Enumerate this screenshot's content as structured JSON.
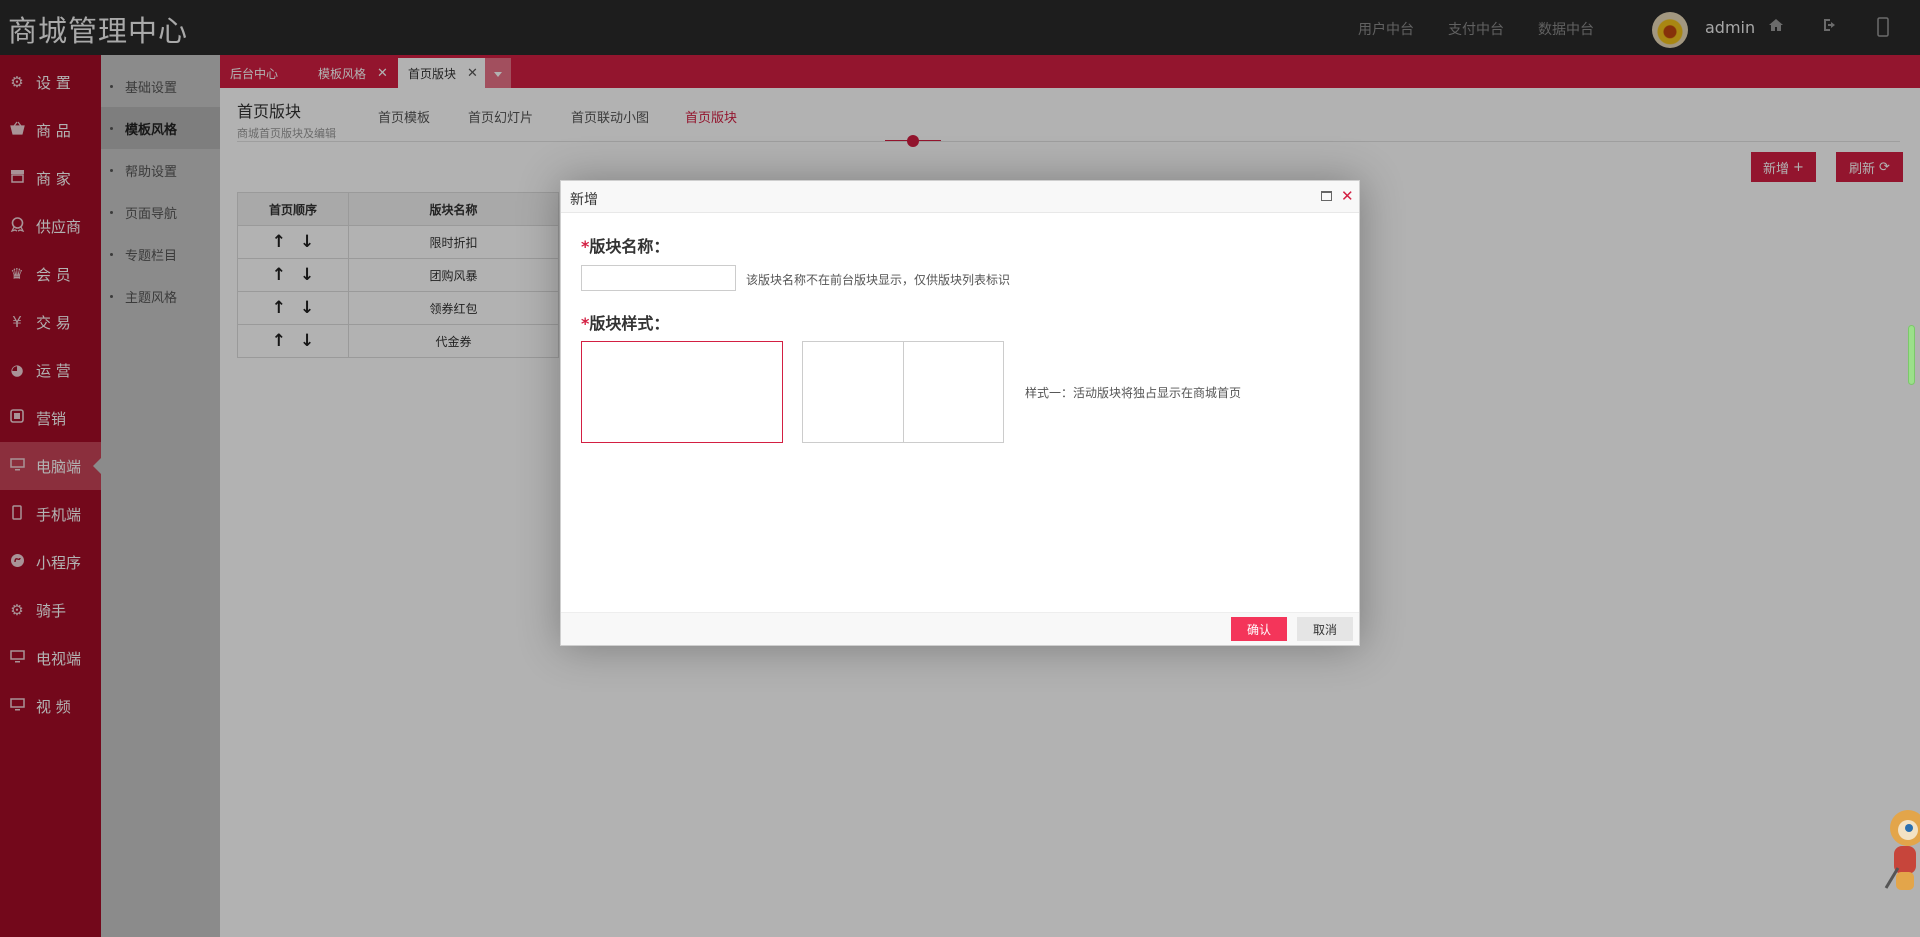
{
  "header": {
    "brand": "商城管理中心",
    "links": [
      "用户中台",
      "支付中台",
      "数据中台"
    ],
    "username": "admin"
  },
  "sidebar": {
    "items": [
      {
        "icon": "gear-icon",
        "label": "设 置"
      },
      {
        "icon": "basket-icon",
        "label": "商 品"
      },
      {
        "icon": "store-icon",
        "label": "商 家"
      },
      {
        "icon": "supplier-icon",
        "label": "供应商"
      },
      {
        "icon": "crown-icon",
        "label": "会 员"
      },
      {
        "icon": "yen-icon",
        "label": "交 易"
      },
      {
        "icon": "pie-chart-icon",
        "label": "运 营"
      },
      {
        "icon": "marketing-icon",
        "label": "营销"
      },
      {
        "icon": "desktop-icon",
        "label": "电脑端",
        "active": true
      },
      {
        "icon": "mobile-icon",
        "label": "手机端"
      },
      {
        "icon": "miniapp-icon",
        "label": "小程序"
      },
      {
        "icon": "gear-icon",
        "label": "骑手"
      },
      {
        "icon": "tv-icon",
        "label": "电视端"
      },
      {
        "icon": "video-icon",
        "label": "视 频"
      }
    ]
  },
  "subnav": {
    "items": [
      {
        "label": "基础设置"
      },
      {
        "label": "模板风格",
        "active": true
      },
      {
        "label": "帮助设置"
      },
      {
        "label": "页面导航"
      },
      {
        "label": "专题栏目"
      },
      {
        "label": "主题风格"
      }
    ]
  },
  "tabs": [
    {
      "label": "后台中心",
      "closable": false
    },
    {
      "label": "模板风格",
      "closable": true
    },
    {
      "label": "首页版块",
      "closable": true,
      "current": true
    }
  ],
  "page": {
    "title": "首页版块",
    "subtitle": "商城首页版块及编辑",
    "tabs": [
      "首页模板",
      "首页幻灯片",
      "首页联动小图",
      "首页版块"
    ],
    "active_tab": "首页版块",
    "add_button": "新增",
    "refresh_button": "刷新"
  },
  "table": {
    "headers": [
      "首页顺序",
      "版块名称"
    ],
    "rows": [
      {
        "name": "限时折扣"
      },
      {
        "name": "团购风暴"
      },
      {
        "name": "领券红包"
      },
      {
        "name": "代金券"
      }
    ]
  },
  "modal": {
    "title": "新增",
    "name_label": "版块名称：",
    "name_value": "",
    "name_hint": "该版块名称不在前台版块显示，仅供版块列表标识",
    "style_label": "版块样式：",
    "style_hint": "样式一：活动版块将独占显示在商城首页",
    "confirm": "确认",
    "cancel": "取消"
  },
  "colors": {
    "accent": "#d31f42",
    "sidebar": "#a50c27",
    "topbar": "#2a2a2a"
  }
}
